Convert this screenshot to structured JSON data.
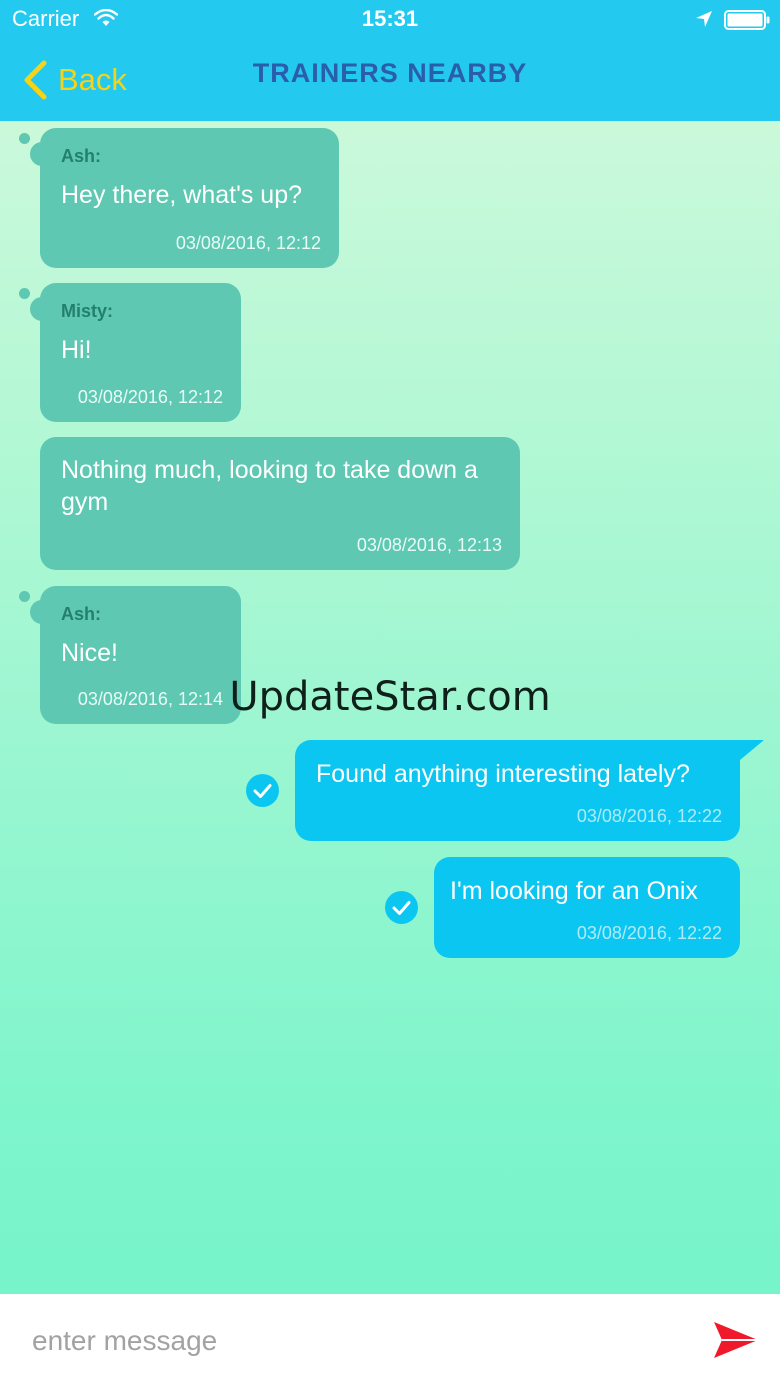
{
  "status_bar": {
    "carrier": "Carrier",
    "time": "15:31"
  },
  "nav": {
    "back_label": "Back",
    "title": "TRAINERS NEARBY"
  },
  "messages": [
    {
      "direction": "incoming",
      "sender": "Ash:",
      "text": "Hey there, what's up?",
      "time": "03/08/2016, 12:12"
    },
    {
      "direction": "incoming",
      "sender": "Misty:",
      "text": "Hi!",
      "time": "03/08/2016, 12:12"
    },
    {
      "direction": "incoming",
      "sender": "",
      "text": "Nothing much, looking to take down a gym",
      "time": "03/08/2016, 12:13"
    },
    {
      "direction": "incoming",
      "sender": "Ash:",
      "text": "Nice!",
      "time": "03/08/2016, 12:14"
    },
    {
      "direction": "outgoing",
      "text": "Found anything interesting lately?",
      "time": "03/08/2016, 12:22",
      "status": "delivered"
    },
    {
      "direction": "outgoing",
      "text": "I'm looking for an Onix",
      "time": "03/08/2016, 12:22",
      "status": "delivered"
    }
  ],
  "watermark": "UpdateStar.com",
  "composer": {
    "placeholder": "enter message",
    "value": ""
  },
  "icons": {
    "wifi": "wifi-icon",
    "location": "location-arrow-icon",
    "battery": "battery-icon",
    "back": "chevron-left-icon",
    "check": "check-circle-icon",
    "send": "send-icon"
  },
  "colors": {
    "nav_bar": "#24c9ef",
    "back_accent": "#f5d316",
    "title": "#2b5dad",
    "incoming_bubble": "#5ec8b2",
    "outgoing_bubble": "#0cc6f2",
    "send": "#f0192b"
  }
}
